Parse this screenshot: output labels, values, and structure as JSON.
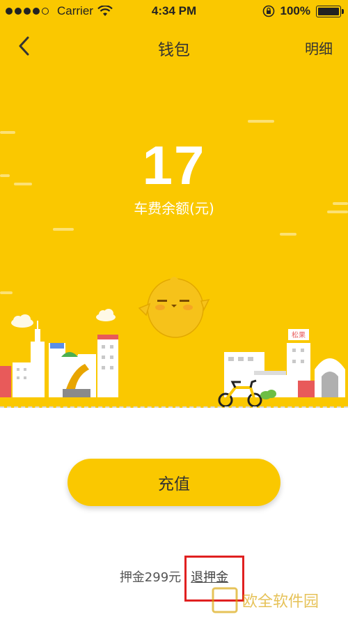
{
  "status_bar": {
    "carrier": "Carrier",
    "time": "4:34 PM",
    "battery": "100%"
  },
  "nav": {
    "title": "钱包",
    "detail_label": "明细"
  },
  "balance": {
    "amount": "17",
    "label": "车费余额(元)"
  },
  "actions": {
    "recharge_label": "充值"
  },
  "deposit": {
    "text": "押金299元",
    "refund_label": "退押金"
  },
  "illustration": {
    "shop_sign": "松果"
  },
  "watermark": {
    "text": "欧全软件园"
  },
  "colors": {
    "brand_yellow": "#FAC800",
    "highlight_red": "#E02020"
  },
  "icons": [
    "back-chevron-icon",
    "wifi-icon",
    "lock-rotation-icon",
    "battery-icon"
  ]
}
